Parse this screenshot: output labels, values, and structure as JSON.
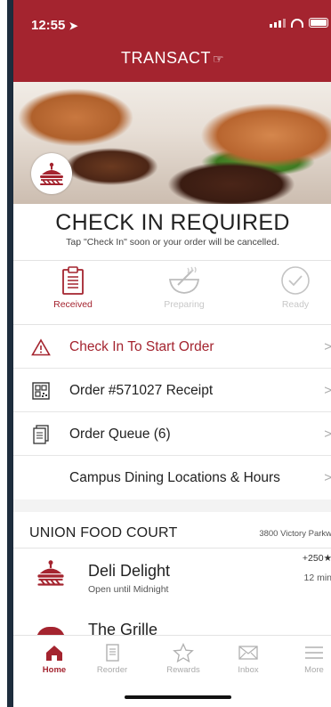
{
  "status_bar": {
    "time": "12:55"
  },
  "header": {
    "brand": "TRANSACT"
  },
  "check_in": {
    "title": "CHECK IN REQUIRED",
    "subtitle": "Tap \"Check In\" soon or your order will be cancelled."
  },
  "steps": [
    {
      "label": "Received",
      "icon": "clipboard-icon",
      "active": true
    },
    {
      "label": "Preparing",
      "icon": "mixing-bowl-icon",
      "active": false
    },
    {
      "label": "Ready",
      "icon": "checkmark-circle-icon",
      "active": false
    }
  ],
  "menu": [
    {
      "label": "Check In To Start Order",
      "icon": "warning-icon",
      "color": "#a4242f"
    },
    {
      "label": "Order #571027 Receipt",
      "icon": "qr-code-icon",
      "color": "#222222"
    },
    {
      "label": "Order Queue (6)",
      "icon": "receipts-icon",
      "color": "#222222"
    },
    {
      "label": "Campus Dining Locations & Hours",
      "icon": "",
      "color": "#222222"
    }
  ],
  "section": {
    "title": "UNION FOOD COURT",
    "address": "3800 Victory Parkw"
  },
  "locations": [
    {
      "name": "Deli Delight",
      "hours": "Open until Midnight",
      "rating": "+250",
      "wait": "12 min"
    },
    {
      "name": "The Grille",
      "hours": "",
      "rating": "",
      "wait": ""
    }
  ],
  "tabs": [
    {
      "label": "Home",
      "icon": "home-icon",
      "active": true
    },
    {
      "label": "Reorder",
      "icon": "receipt-icon",
      "active": false
    },
    {
      "label": "Rewards",
      "icon": "star-icon",
      "active": false
    },
    {
      "label": "Inbox",
      "icon": "envelope-icon",
      "active": false
    },
    {
      "label": "More",
      "icon": "menu-icon",
      "active": false
    }
  ],
  "colors": {
    "brand": "#a4242f",
    "inactive": "#aaaaaa"
  }
}
